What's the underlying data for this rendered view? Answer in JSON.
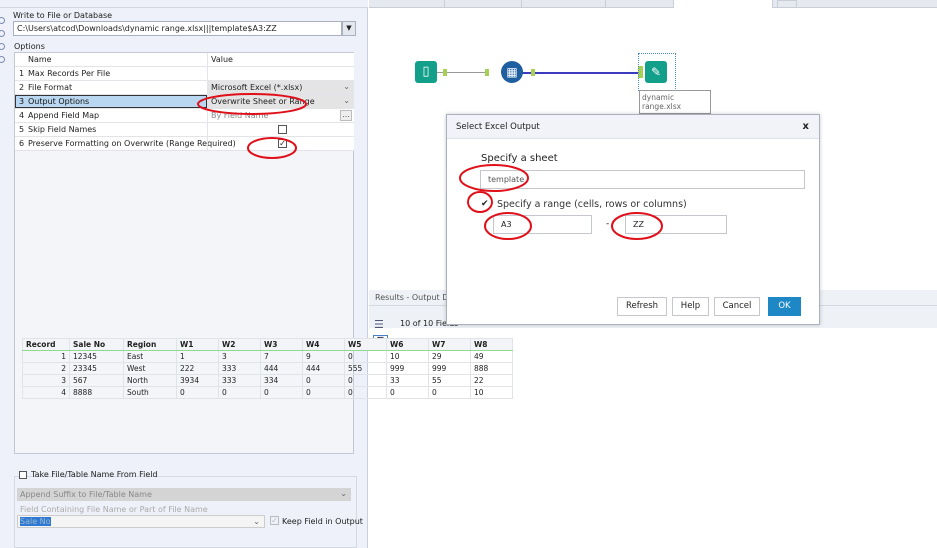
{
  "config": {
    "write_label": "Write to File or Database",
    "path": "C:\\Users\\atcod\\Downloads\\dynamic range.xlsx|||template$A3:ZZ",
    "options_label": "Options",
    "col_name": "Name",
    "col_value": "Value",
    "rows": [
      {
        "num": "1",
        "name": "Max Records Per File",
        "value": ""
      },
      {
        "num": "2",
        "name": "File Format",
        "value": "Microsoft Excel (*.xlsx)"
      },
      {
        "num": "3",
        "name": "Output Options",
        "value": "Overwrite Sheet or Range"
      },
      {
        "num": "4",
        "name": "Append Field Map",
        "value": "By Field Name"
      },
      {
        "num": "5",
        "name": "Skip Field Names",
        "value": "",
        "checked": false
      },
      {
        "num": "6",
        "name": "Preserve Formatting on Overwrite (Range Required)",
        "value": "",
        "checked": true
      }
    ],
    "take_name_label": "Take File/Table Name From Field",
    "suffix_select": "Append Suffix to File/Table Name",
    "field_label": "Field Containing File Name or Part of File Name",
    "field_value": "Sale No",
    "keep_field_label": "Keep Field in Output"
  },
  "canvas": {
    "node_label": "dynamic\nrange.xlsx"
  },
  "dialog": {
    "title": "Select Excel Output",
    "close": "x",
    "sheet_label": "Specify a sheet",
    "sheet_value": "template",
    "range_label": "Specify a range (cells, rows or columns)",
    "range_checked": true,
    "range_start": "A3",
    "range_sep": "-",
    "range_end": "ZZ",
    "buttons": {
      "refresh": "Refresh",
      "help": "Help",
      "cancel": "Cancel",
      "ok": "OK"
    }
  },
  "results": {
    "title": "Results - Output Data",
    "fields": "10 of 10 Fields",
    "headers": [
      "Record",
      "Sale No",
      "Region",
      "W1",
      "W2",
      "W3",
      "W4",
      "W5",
      "W6",
      "W7",
      "W8"
    ],
    "rows": [
      [
        "1",
        "12345",
        "East",
        "1",
        "3",
        "7",
        "9",
        "0",
        "10",
        "29",
        "49"
      ],
      [
        "2",
        "23345",
        "West",
        "222",
        "333",
        "444",
        "444",
        "555",
        "999",
        "999",
        "888"
      ],
      [
        "3",
        "567",
        "North",
        "3934",
        "333",
        "334",
        "0",
        "0",
        "33",
        "55",
        "22"
      ],
      [
        "4",
        "8888",
        "South",
        "0",
        "0",
        "0",
        "0",
        "0",
        "0",
        "0",
        "10"
      ]
    ]
  },
  "colors": {
    "accent": "#1e87c5",
    "selection": "#b9d7f1",
    "annotation": "#e0101a",
    "tool_teal": "#12a08a"
  }
}
